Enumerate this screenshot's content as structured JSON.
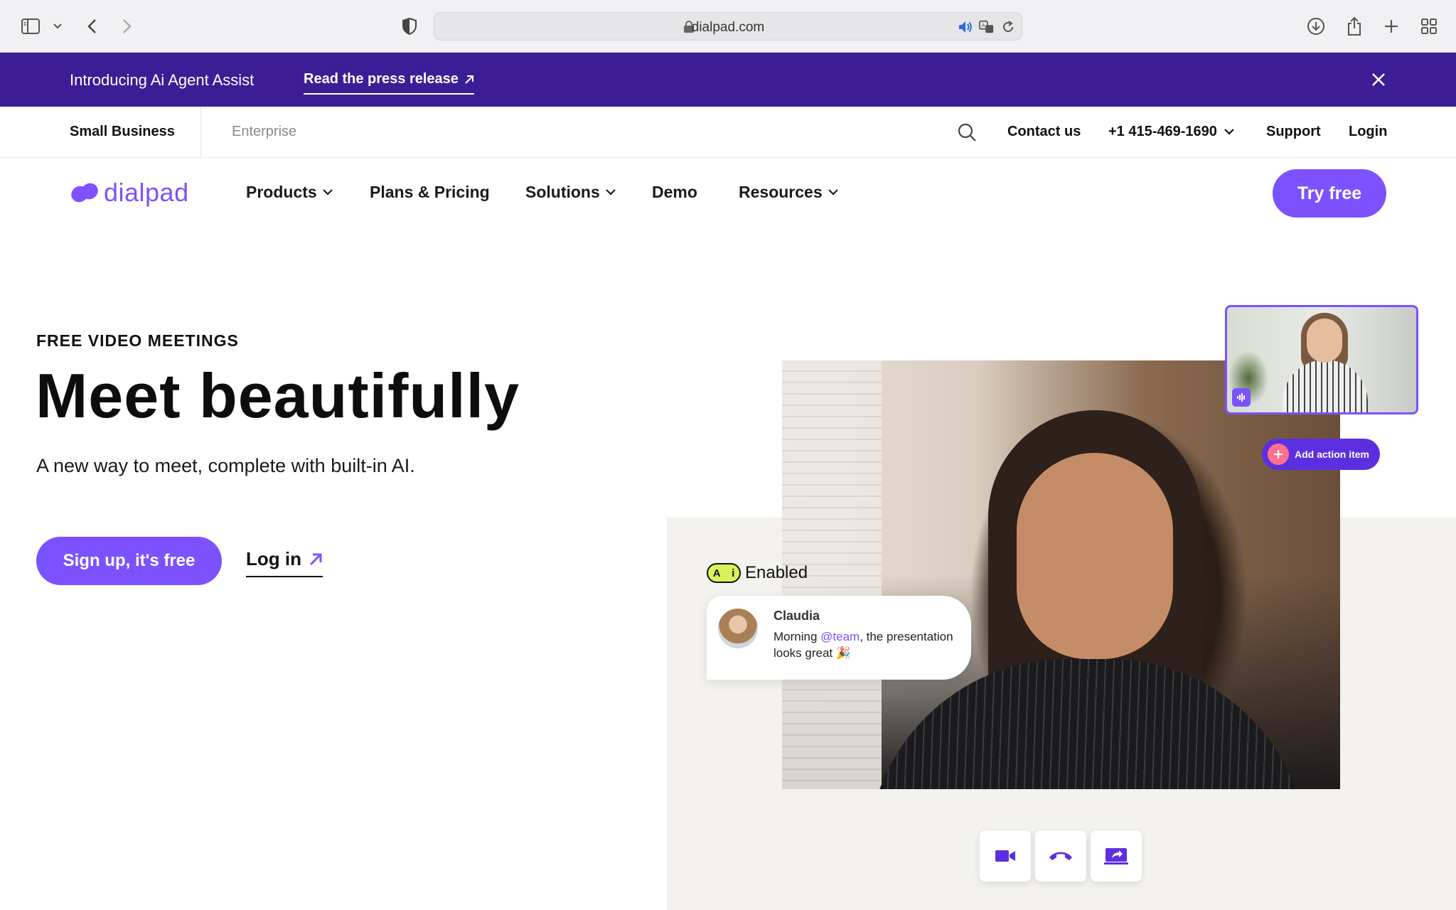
{
  "browser": {
    "url": "dialpad.com"
  },
  "announcement": {
    "intro": "Introducing Ai Agent Assist",
    "link": "Read the press release"
  },
  "utility_nav": {
    "segments": [
      "Small Business",
      "Enterprise"
    ],
    "contact": "Contact us",
    "phone": "+1 415-469-1690",
    "support": "Support",
    "login": "Login"
  },
  "main_nav": {
    "logo": "dialpad",
    "items": [
      {
        "label": "Products",
        "dropdown": true
      },
      {
        "label": "Plans & Pricing",
        "dropdown": false
      },
      {
        "label": "Solutions",
        "dropdown": true
      },
      {
        "label": "Demo",
        "dropdown": false
      },
      {
        "label": "Resources",
        "dropdown": true
      }
    ],
    "cta": "Try free"
  },
  "hero": {
    "eyebrow": "FREE VIDEO MEETINGS",
    "headline": "Meet beautifully",
    "subline": "A new way to meet, complete with built-in AI.",
    "signup": "Sign up, it's free",
    "login": "Log in"
  },
  "visual": {
    "action_item": "Add action item",
    "ai_badge": "A i",
    "ai_label": "Enabled",
    "chat": {
      "name": "Claudia",
      "msg_before": "Morning ",
      "mention": "@team",
      "msg_after": ", the presentation looks great 🎉"
    }
  },
  "colors": {
    "brand": "#7c52ff",
    "banner": "#3b1e96",
    "ai_badge": "#d8f25a"
  }
}
